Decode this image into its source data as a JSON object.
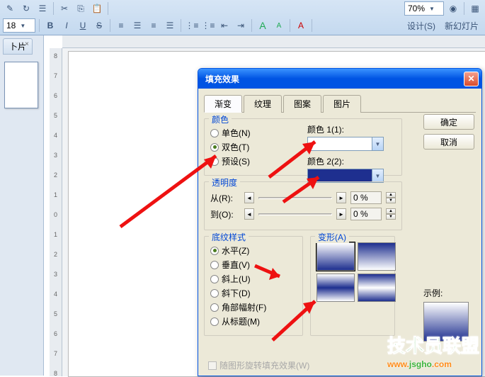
{
  "toolbar": {
    "font_size": "18",
    "zoom": "70%",
    "bold": "B",
    "italic": "I",
    "underline": "U",
    "strike": "S",
    "design": "设计(S)",
    "new_slide": "新幻灯片",
    "font_shrink": "A",
    "font_grow": "A"
  },
  "left_panel": {
    "tab": "卜片"
  },
  "dialog": {
    "title": "填充效果",
    "tabs": {
      "gradient": "渐变",
      "texture": "纹理",
      "pattern": "图案",
      "picture": "图片"
    },
    "ok": "确定",
    "cancel": "取消",
    "colors": {
      "legend": "颜色",
      "one": "单色(N)",
      "two": "双色(T)",
      "preset": "预设(S)",
      "color1_label": "颜色 1(1):",
      "color2_label": "颜色 2(2):",
      "color1_value": "#ffffff",
      "color2_value": "#1e2f8f"
    },
    "transparency": {
      "legend": "透明度",
      "from": "从(R):",
      "to": "到(O):",
      "from_val": "0 %",
      "to_val": "0 %"
    },
    "shading": {
      "legend": "底纹样式",
      "horizontal": "水平(Z)",
      "vertical": "垂直(V)",
      "diag_up": "斜上(U)",
      "diag_down": "斜下(D)",
      "from_corner": "角部幅射(F)",
      "from_title": "从标题(M)"
    },
    "variants": {
      "legend": "变形(A)"
    },
    "example": {
      "legend": "示例:"
    },
    "rotate": "随图形旋转填充效果(W)"
  },
  "watermark": {
    "cn": "技术员联盟",
    "url_1": "www.",
    "url_2": "jsgho",
    "url_3": ".com"
  }
}
